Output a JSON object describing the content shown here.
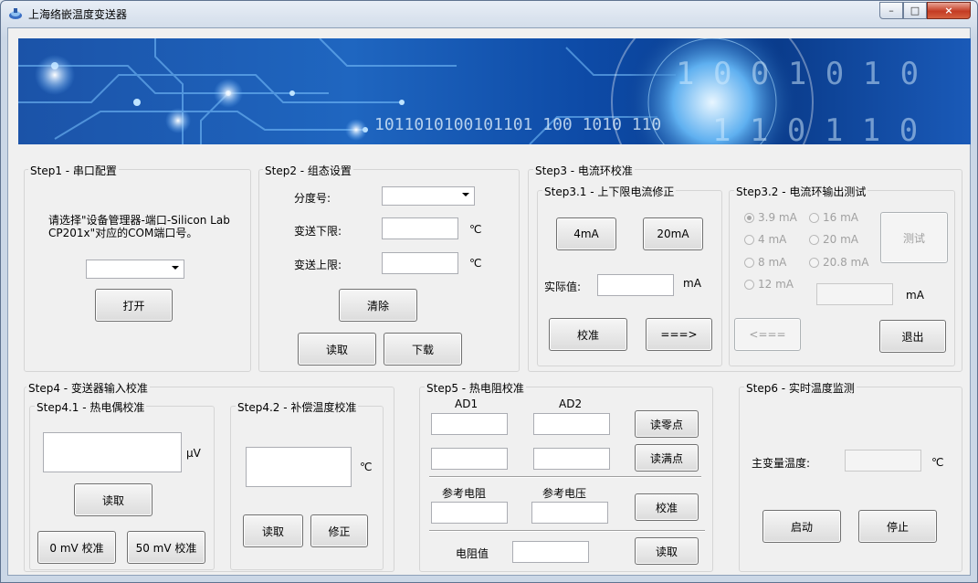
{
  "window": {
    "title": "上海络嵌温度变送器",
    "min_label": "–",
    "max_label": "□",
    "close_label": "×"
  },
  "banner": {
    "bits_text": "1011010100101101 100 1010 110"
  },
  "step1": {
    "title": "Step1 - 串口配置",
    "instruction_line1": "请选择\"设备管理器-端口-Silicon Lab",
    "instruction_line2": "CP201x\"对应的COM端口号。",
    "com_port": "",
    "open_button": "打开"
  },
  "step2": {
    "title": "Step2 - 组态设置",
    "index_label": "分度号:",
    "index_value": "",
    "lower_label": "变送下限:",
    "lower_value": "",
    "lower_unit": "℃",
    "upper_label": "变送上限:",
    "upper_value": "",
    "upper_unit": "℃",
    "clear_button": "清除",
    "read_button": "读取",
    "download_button": "下载"
  },
  "step3": {
    "title": "Step3 - 电流环校准",
    "sub1_title": "Step3.1 - 上下限电流修正",
    "btn_4ma": "4mA",
    "btn_20ma": "20mA",
    "actual_label": "实际值:",
    "actual_value": "",
    "actual_unit": "mA",
    "calibrate_button": "校准",
    "forward_button": "===>",
    "sub2_title": "Step3.2 - 电流环输出测试",
    "radios": [
      {
        "label": "3.9 mA",
        "checked": true
      },
      {
        "label": "16 mA",
        "checked": false
      },
      {
        "label": "4 mA",
        "checked": false
      },
      {
        "label": "20 mA",
        "checked": false
      },
      {
        "label": "8 mA",
        "checked": false
      },
      {
        "label": "20.8 mA",
        "checked": false
      },
      {
        "label": "12 mA",
        "checked": false
      }
    ],
    "test_button": "测试",
    "output_value": "",
    "output_unit": "mA",
    "back_button": "<===",
    "exit_button": "退出"
  },
  "step4": {
    "title": "Step4 - 变送器输入校准",
    "sub1_title": "Step4.1 - 热电偶校准",
    "tc_value": "",
    "tc_unit": "μV",
    "read_button": "读取",
    "zero_button": "0 mV 校准",
    "fifty_button": "50 mV 校准",
    "sub2_title": "Step4.2 - 补偿温度校准",
    "comp_value": "",
    "comp_unit": "℃",
    "comp_read_button": "读取",
    "comp_fix_button": "修正"
  },
  "step5": {
    "title": "Step5 - 热电阻校准",
    "ad1_label": "AD1",
    "ad2_label": "AD2",
    "ad1_zero": "",
    "ad2_zero": "",
    "ad1_full": "",
    "ad2_full": "",
    "read_zero_button": "读零点",
    "read_full_button": "读满点",
    "ref_res_label": "参考电阻",
    "ref_volt_label": "参考电压",
    "ref_res_value": "",
    "ref_volt_value": "",
    "calibrate_button": "校准",
    "res_label": "电阻值",
    "res_value": "",
    "read_button": "读取"
  },
  "step6": {
    "title": "Step6 - 实时温度监测",
    "temp_label": "主变量温度:",
    "temp_value": "",
    "temp_unit": "℃",
    "start_button": "启动",
    "stop_button": "停止"
  }
}
